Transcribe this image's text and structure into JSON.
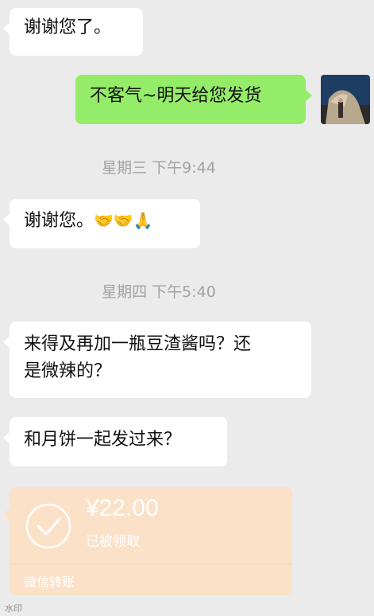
{
  "messages": {
    "m1": "谢谢您了。",
    "m2": "不客气~明天给您发货",
    "t1": "星期三 下午9:44",
    "m3_text": "谢谢您。",
    "m3_emoji": "🤝🤝🙏",
    "t2": "星期四 下午5:40",
    "m4_line1": "来得及再加一瓶豆渣酱吗？还",
    "m4_line2": "是微辣的？",
    "m5": "和月饼一起发过来？"
  },
  "transfer": {
    "amount": "¥22.00",
    "status": "已被领取",
    "label": "微信转账"
  },
  "watermark": "水印"
}
